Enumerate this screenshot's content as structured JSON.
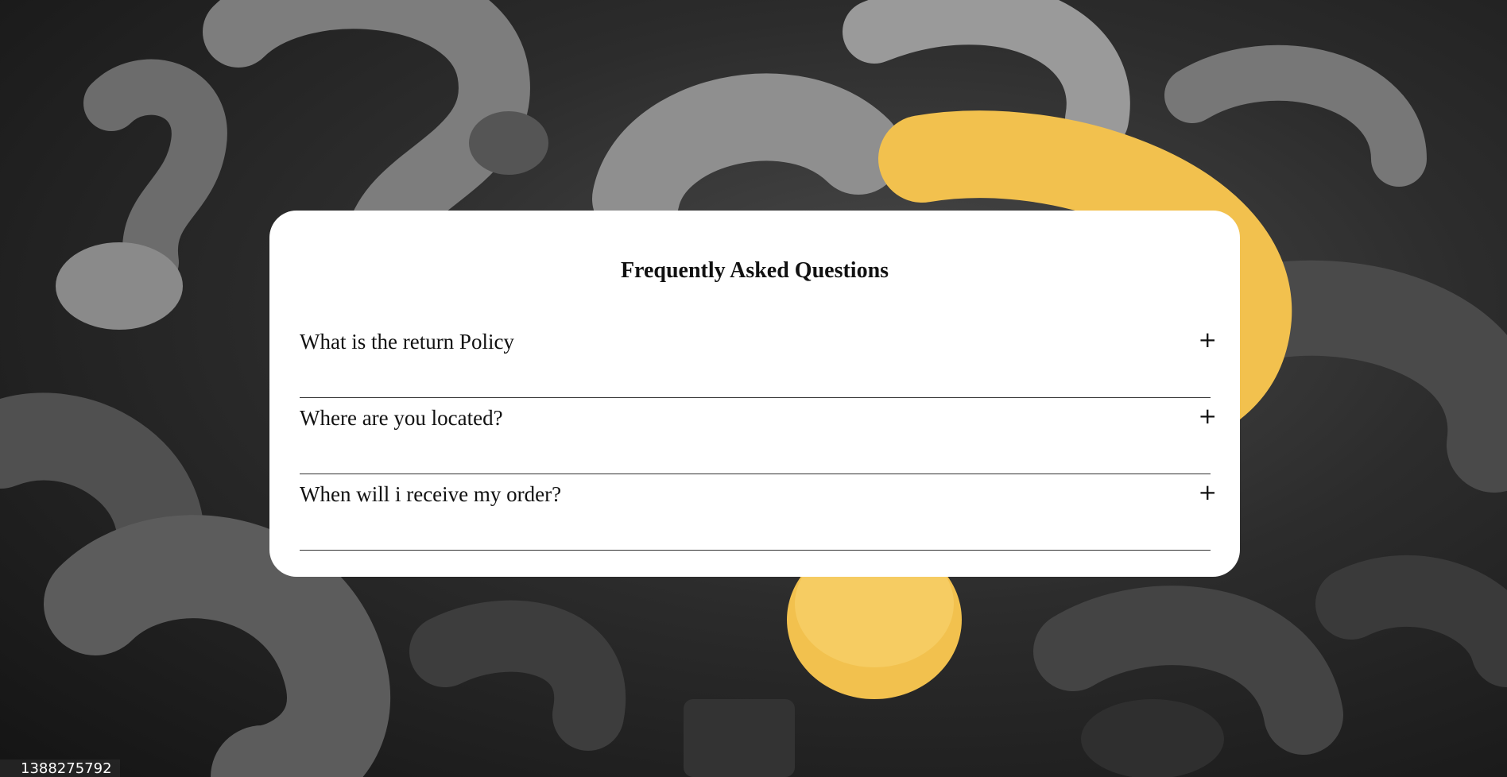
{
  "background": {
    "watermark_text": "1388275792",
    "accent_color": "#f2c14e",
    "shape_color": "#5a5a5a"
  },
  "faq": {
    "title": "Frequently Asked Questions",
    "items": [
      {
        "question": "What is the return Policy",
        "toggle": "+",
        "expanded": false
      },
      {
        "question": "Where are you located?",
        "toggle": "+",
        "expanded": false
      },
      {
        "question": "When will i receive my order?",
        "toggle": "+",
        "expanded": false
      }
    ]
  }
}
